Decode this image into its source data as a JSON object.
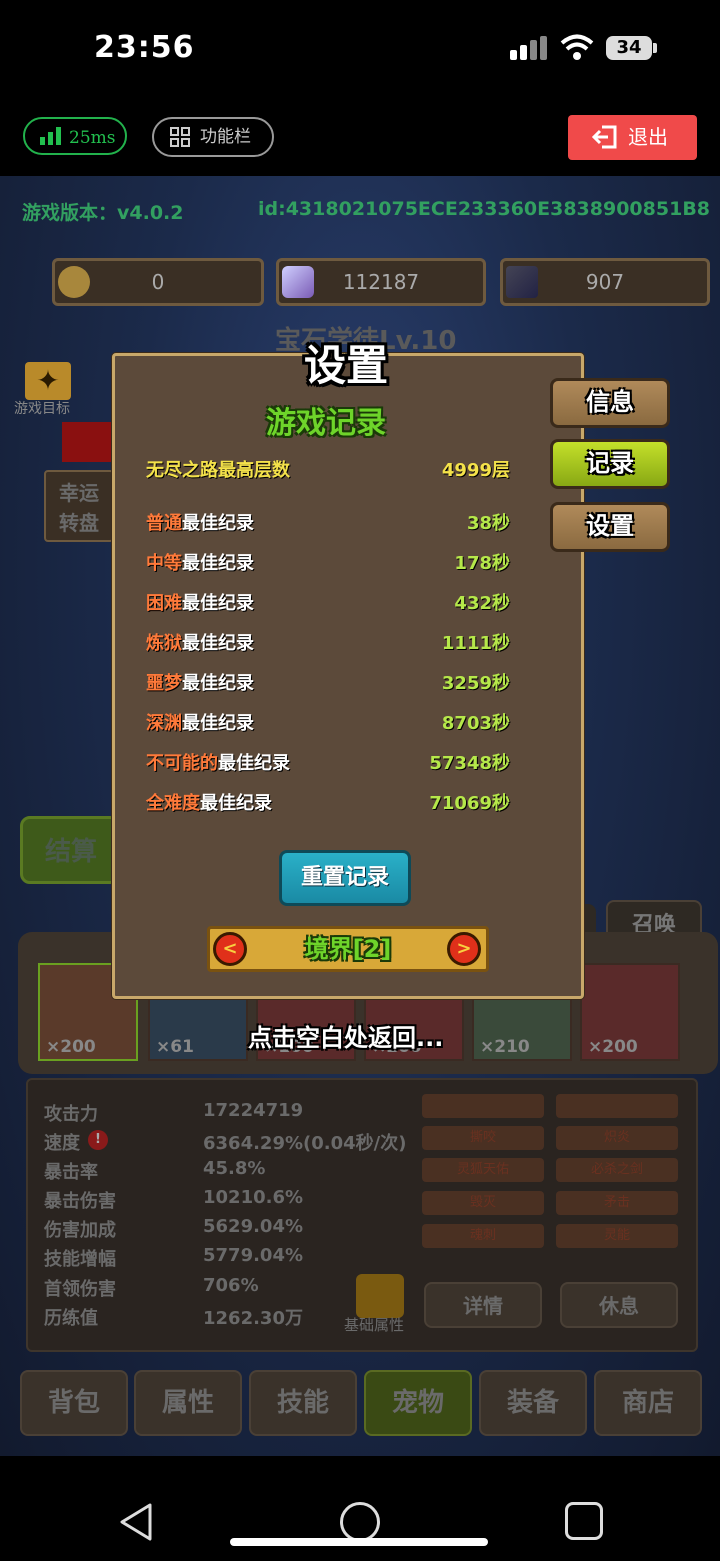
{
  "status_bar": {
    "time": "23:56",
    "battery": "34"
  },
  "top_bar": {
    "ping": "25ms",
    "function_bar": "功能栏",
    "exit": "退出"
  },
  "game_hud": {
    "version": "游戏版本：v4.0.2",
    "id": "id:4318021075ECE233360E3838900851B8",
    "coins": "0",
    "gems": "112187",
    "cards": "907",
    "gem_level": "宝石学徒Lv.10",
    "goal_label": "游戏目标",
    "lucky_wheel": [
      "幸运",
      "转盘"
    ],
    "settle": "结算",
    "summon": "召唤"
  },
  "pets": [
    {
      "count": "×200"
    },
    {
      "count": "×61"
    },
    {
      "count": "×100"
    },
    {
      "count": "×200"
    },
    {
      "count": "×210"
    },
    {
      "count": "×200"
    }
  ],
  "stats": [
    {
      "label": "攻击力",
      "value": "17224719"
    },
    {
      "label": "速度",
      "value": "6364.29%(0.04秒/次)"
    },
    {
      "label": "暴击率",
      "value": "45.8%"
    },
    {
      "label": "暴击伤害",
      "value": "10210.6%"
    },
    {
      "label": "伤害加成",
      "value": "5629.04%"
    },
    {
      "label": "技能增幅",
      "value": "5779.04%"
    },
    {
      "label": "首领伤害",
      "value": "706%"
    },
    {
      "label": "历练值",
      "value": "1262.30万"
    }
  ],
  "skills": [
    "撕咬",
    "炽炎",
    "灵狐天佑",
    "必杀之剑",
    "毁灭",
    "矛击",
    "魂刺",
    "灵能"
  ],
  "stat_buttons": {
    "detail": "详情",
    "rest": "休息",
    "basic": "基础属性"
  },
  "tabs": [
    "背包",
    "属性",
    "技能",
    "宠物",
    "装备",
    "商店"
  ],
  "dialog": {
    "title": "设置",
    "section": "游戏记录",
    "side_buttons": [
      "信息",
      "记录",
      "设置"
    ],
    "endless": {
      "label": "无尽之路最高层数",
      "value": "4999层"
    },
    "records": [
      {
        "difficulty": "普通",
        "suffix": "最佳纪录",
        "value": "38秒"
      },
      {
        "difficulty": "中等",
        "suffix": "最佳纪录",
        "value": "178秒"
      },
      {
        "difficulty": "困难",
        "suffix": "最佳纪录",
        "value": "432秒"
      },
      {
        "difficulty": "炼狱",
        "suffix": "最佳纪录",
        "value": "1111秒"
      },
      {
        "difficulty": "噩梦",
        "suffix": "最佳纪录",
        "value": "3259秒"
      },
      {
        "difficulty": "深渊",
        "suffix": "最佳纪录",
        "value": "8703秒"
      },
      {
        "difficulty": "不可能的",
        "suffix": "最佳纪录",
        "value": "57348秒"
      },
      {
        "difficulty": "全难度",
        "suffix": "最佳纪录",
        "value": "71069秒"
      }
    ],
    "reset_button": "重置记录",
    "realm": "境界[2]",
    "hint": "点击空白处返回..."
  },
  "colors": {
    "accent_green": "#6ed42a",
    "exit_red": "#f04a4a",
    "difficulty_orange": "#ff7a3a",
    "value_green": "#b6e84a"
  }
}
